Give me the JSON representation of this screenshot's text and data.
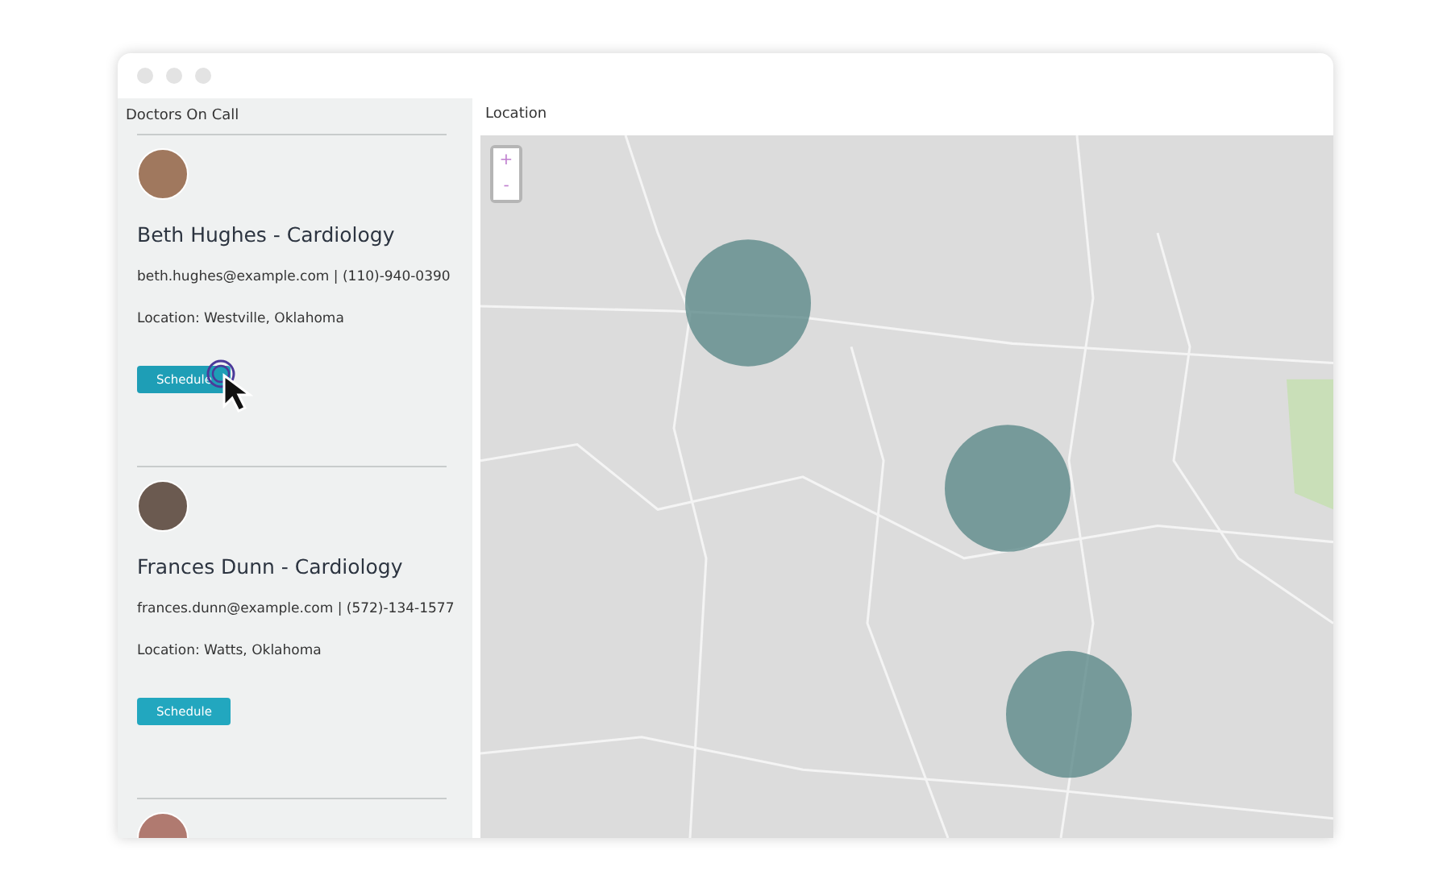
{
  "sidebar": {
    "title": "Doctors On Call",
    "doctors": [
      {
        "name": "Beth Hughes - Cardiology",
        "contact": "beth.hughes@example.com | (110)-940-0390",
        "location": "Location: Westville, Oklahoma",
        "button": "Schedule",
        "hovered": true
      },
      {
        "name": "Frances Dunn - Cardiology",
        "contact": "frances.dunn@example.com | (572)-134-1577",
        "location": "Location: Watts, Oklahoma",
        "button": "Schedule",
        "hovered": false
      }
    ]
  },
  "map": {
    "title": "Location",
    "zoom_in": "+",
    "zoom_out": "-"
  }
}
